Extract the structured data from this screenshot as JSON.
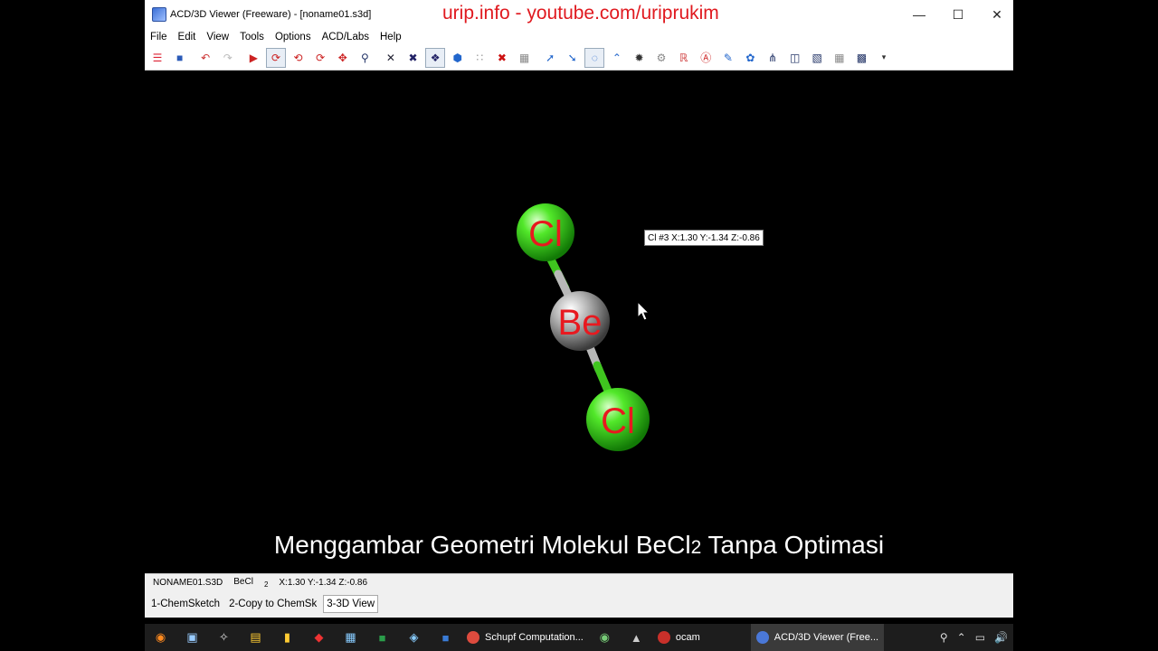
{
  "window": {
    "title": "ACD/3D Viewer (Freeware) - [noname01.s3d]",
    "watermark": "urip.info - youtube.com/uriprukim",
    "controls": {
      "minimize": "—",
      "maximize": "☐",
      "close": "✕"
    }
  },
  "menu": [
    "File",
    "Edit",
    "View",
    "Tools",
    "Options",
    "ACD/Labs",
    "Help"
  ],
  "toolbar": {
    "icons": [
      "open-icon",
      "save-icon",
      "undo-icon",
      "redo-icon",
      "select-icon",
      "rotate-icon",
      "rotate-y-icon",
      "rotate-z-icon",
      "move-icon",
      "zoom-icon",
      "stick-icon",
      "wire-icon",
      "ball-stick-icon",
      "spacefill-icon",
      "dots-icon",
      "dotted-surface-icon",
      "grid-icon",
      "measure-icon",
      "angle-icon",
      "bond-icon",
      "torsion-icon",
      "atom-label-icon",
      "optimize-icon",
      "rs-icon",
      "a-label-icon",
      "color-icon",
      "molecule-icon",
      "tree-icon",
      "page-icon",
      "film-icon",
      "layout-icon",
      "export-icon",
      "overflow-icon"
    ]
  },
  "viewport": {
    "atoms": [
      {
        "symbol": "Cl",
        "color": "#33cc1f"
      },
      {
        "symbol": "Be",
        "color": "#9a9a9a"
      },
      {
        "symbol": "Cl",
        "color": "#33cc1f"
      }
    ],
    "label_color": "#e8191f",
    "tooltip": "Cl  #3  X:1.30 Y:-1.34 Z:-0.86",
    "caption_before": "Menggambar Geometri Molekul BeCl",
    "caption_sub": "2",
    "caption_after": " Tanpa Optimasi"
  },
  "status": {
    "file": "NONAME01.S3D",
    "formula": "BeCl",
    "formula_sub": "2",
    "coords": "X:1.30 Y:-1.34 Z:-0.86"
  },
  "tabs": [
    {
      "label": "1-ChemSketch",
      "active": false
    },
    {
      "label": "2-Copy to ChemSk",
      "active": false
    },
    {
      "label": "3-3D View",
      "active": true
    }
  ],
  "taskbar": {
    "apps": [
      {
        "label": "Schupf Computation...",
        "color": "#dd4b3e"
      },
      {
        "label": "ocam",
        "color": "#c8302a"
      },
      {
        "label": "ACD/3D Viewer (Free...",
        "color": "#4a78d8",
        "active": true
      }
    ]
  }
}
